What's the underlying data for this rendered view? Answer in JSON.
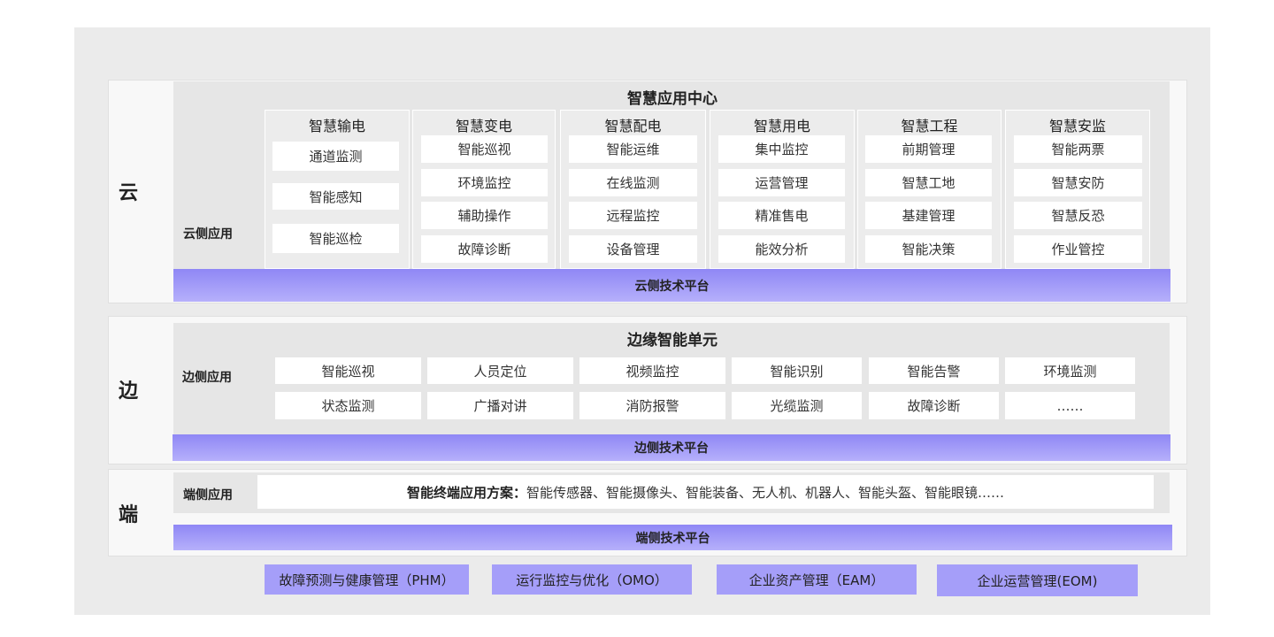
{
  "cloud": {
    "layer_label": "云",
    "side_label": "云侧应用",
    "center_title": "智慧应用中心",
    "columns": [
      {
        "title": "智慧输电",
        "items": [
          "通道监测",
          "智能感知",
          "智能巡检"
        ]
      },
      {
        "title": "智慧变电",
        "items": [
          "智能巡视",
          "环境监控",
          "辅助操作",
          "故障诊断"
        ]
      },
      {
        "title": "智慧配电",
        "items": [
          "智能运维",
          "在线监测",
          "远程监控",
          "设备管理"
        ]
      },
      {
        "title": "智慧用电",
        "items": [
          "集中监控",
          "运营管理",
          "精准售电",
          "能效分析"
        ]
      },
      {
        "title": "智慧工程",
        "items": [
          "前期管理",
          "智慧工地",
          "基建管理",
          "智能决策"
        ]
      },
      {
        "title": "智慧安监",
        "items": [
          "智能两票",
          "智慧安防",
          "智慧反恐",
          "作业管控"
        ]
      }
    ],
    "platform": "云侧技术平台"
  },
  "edge": {
    "layer_label": "边",
    "side_label": "边侧应用",
    "center_title": "边缘智能单元",
    "row1": [
      "智能巡视",
      "人员定位",
      "视频监控",
      "智能识别",
      "智能告警",
      "环境监测"
    ],
    "row2": [
      "状态监测",
      "广播对讲",
      "消防报警",
      "光缆监测",
      "故障诊断",
      "……"
    ],
    "platform": "边侧技术平台"
  },
  "terminal": {
    "layer_label": "端",
    "side_label": "端侧应用",
    "solution_label": "智能终端应用方案：",
    "solution_text": "智能传感器、智能摄像头、智能装备、无人机、机器人、智能头盔、智能眼镜……",
    "platform": "端侧技术平台"
  },
  "footer": [
    "故障预测与健康管理（PHM）",
    "运行监控与优化（OMO）",
    "企业资产管理（EAM）",
    "企业运营管理(EOM)"
  ]
}
